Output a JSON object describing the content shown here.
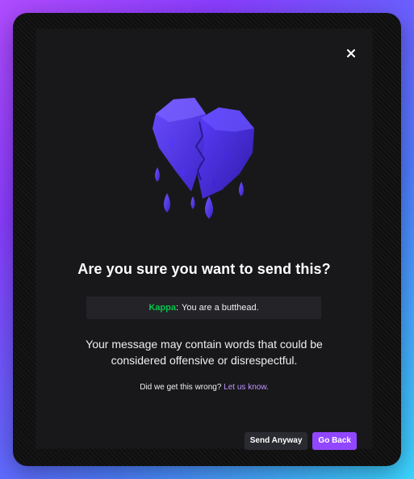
{
  "dialog": {
    "title": "Are you sure you want to send this?",
    "message": {
      "username": "Kappa",
      "separator": ":",
      "text": "You are a butthead."
    },
    "warning": "Your message may contain words that could be considered offensive or disrespectful.",
    "feedback_prompt": "Did we get this wrong?",
    "feedback_link": "Let us know.",
    "buttons": {
      "send_anyway": "Send Anyway",
      "go_back": "Go Back"
    },
    "close_icon": "close-icon",
    "hero_icon": "crying-heart-icon"
  },
  "colors": {
    "background_start": "#b04cff",
    "background_end": "#3ad6ff",
    "dialog_bg": "#18181b",
    "username": "#00c84a",
    "link": "#bf94ff",
    "primary": "#9147ff"
  }
}
